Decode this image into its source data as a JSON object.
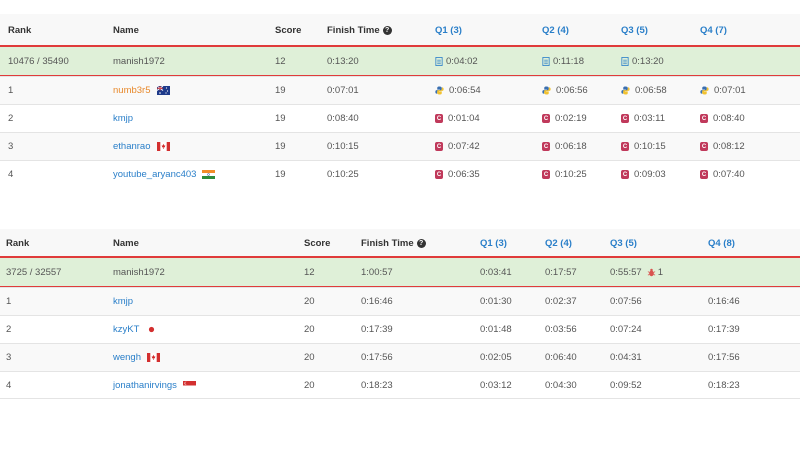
{
  "table1": {
    "headers": {
      "rank": "Rank",
      "name": "Name",
      "score": "Score",
      "finish": "Finish Time",
      "q1": "Q1 (3)",
      "q2": "Q2 (4)",
      "q3": "Q3 (5)",
      "q4": "Q4 (7)"
    },
    "me": {
      "rank": "10476 / 35490",
      "name": "manish1972",
      "score": "12",
      "finish": "0:13:20",
      "q1": "0:04:02",
      "q2": "0:11:18",
      "q3": "0:13:20",
      "q4": ""
    },
    "rows": [
      {
        "rank": "1",
        "name": "numb3r5",
        "score": "19",
        "finish": "0:07:01",
        "q1": "0:06:54",
        "q2": "0:06:56",
        "q3": "0:06:58",
        "q4": "0:07:01",
        "lang": "py",
        "flag": "au",
        "name_color": "orange"
      },
      {
        "rank": "2",
        "name": "kmjp",
        "score": "19",
        "finish": "0:08:40",
        "q1": "0:01:04",
        "q2": "0:02:19",
        "q3": "0:03:11",
        "q4": "0:08:40",
        "lang": "cpp",
        "flag": "",
        "name_color": "blue"
      },
      {
        "rank": "3",
        "name": "ethanrao",
        "score": "19",
        "finish": "0:10:15",
        "q1": "0:07:42",
        "q2": "0:06:18",
        "q3": "0:10:15",
        "q4": "0:08:12",
        "lang": "cpp",
        "flag": "ca",
        "name_color": "blue"
      },
      {
        "rank": "4",
        "name": "youtube_aryanc403",
        "score": "19",
        "finish": "0:10:25",
        "q1": "0:06:35",
        "q2": "0:10:25",
        "q3": "0:09:03",
        "q4": "0:07:40",
        "lang": "cpp",
        "flag": "in",
        "name_color": "blue"
      }
    ]
  },
  "table2": {
    "headers": {
      "rank": "Rank",
      "name": "Name",
      "score": "Score",
      "finish": "Finish Time",
      "q1": "Q1 (3)",
      "q2": "Q2 (4)",
      "q3": "Q3 (5)",
      "q4": "Q4 (8)"
    },
    "me": {
      "rank": "3725 / 32557",
      "name": "manish1972",
      "score": "12",
      "finish": "1:00:57",
      "q1": "0:03:41",
      "q2": "0:17:57",
      "q3": "0:55:57",
      "q3_bugs": "1",
      "q4": ""
    },
    "rows": [
      {
        "rank": "1",
        "name": "kmjp",
        "score": "20",
        "finish": "0:16:46",
        "q1": "0:01:30",
        "q2": "0:02:37",
        "q3": "0:07:56",
        "q4": "0:16:46",
        "flag": ""
      },
      {
        "rank": "2",
        "name": "kzyKT",
        "score": "20",
        "finish": "0:17:39",
        "q1": "0:01:48",
        "q2": "0:03:56",
        "q3": "0:07:24",
        "q4": "0:17:39",
        "flag": "jp"
      },
      {
        "rank": "3",
        "name": "wengh",
        "score": "20",
        "finish": "0:17:56",
        "q1": "0:02:05",
        "q2": "0:06:40",
        "q3": "0:04:31",
        "q4": "0:17:56",
        "flag": "ca"
      },
      {
        "rank": "4",
        "name": "jonathanirvings",
        "score": "20",
        "finish": "0:18:23",
        "q1": "0:03:12",
        "q2": "0:04:30",
        "q3": "0:09:52",
        "q4": "0:18:23",
        "flag": "sg"
      }
    ]
  },
  "colors": {
    "highlight_border": "#e03b3b",
    "highlight_bg": "#dff0d8",
    "link": "#2a7fc9",
    "top_rank": "#e8892b",
    "cpp_icon": "#c0395b"
  }
}
